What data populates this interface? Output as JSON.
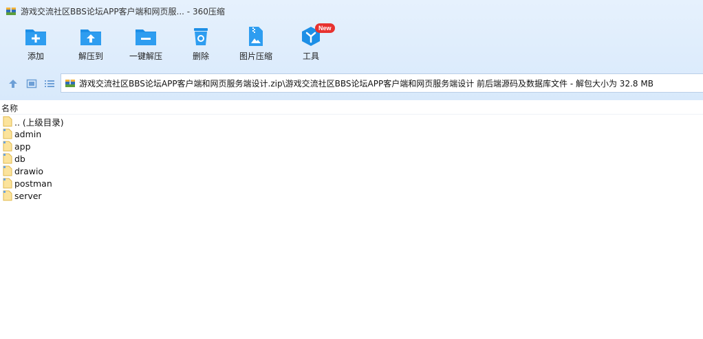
{
  "window": {
    "title": "游戏交流社区BBS论坛APP客户端和网页服... - 360压缩"
  },
  "toolbar": {
    "add": "添加",
    "extract_to": "解压到",
    "one_click_extract": "一键解压",
    "delete": "删除",
    "image_compress": "图片压缩",
    "tools": "工具",
    "new_badge": "New"
  },
  "colors": {
    "accent": "#1d8fe6",
    "badge": "#e8322f"
  },
  "nav": {
    "path": "游戏交流社区BBS论坛APP客户端和网页服务端设计.zip\\游戏交流社区BBS论坛APP客户端和网页服务端设计 前后端源码及数据库文件 - 解包大小为 32.8 MB"
  },
  "list": {
    "column_name": "名称",
    "items": [
      {
        "name": ".. (上级目录)",
        "type": "parent"
      },
      {
        "name": "admin",
        "type": "folder"
      },
      {
        "name": "app",
        "type": "folder"
      },
      {
        "name": "db",
        "type": "folder"
      },
      {
        "name": "drawio",
        "type": "folder"
      },
      {
        "name": "postman",
        "type": "folder"
      },
      {
        "name": "server",
        "type": "folder"
      }
    ]
  }
}
